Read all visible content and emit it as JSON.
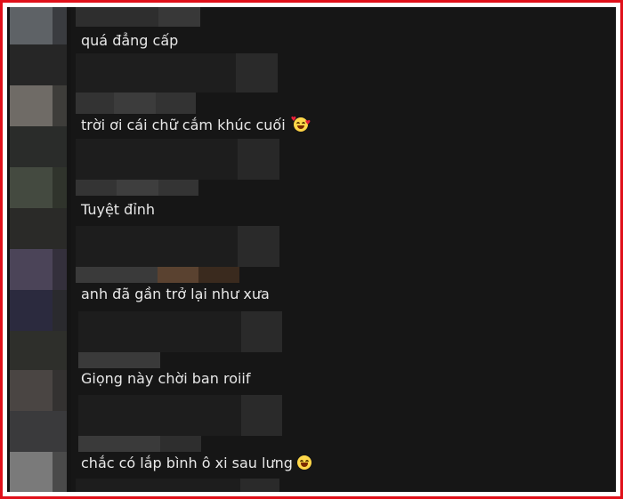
{
  "comments": [
    {
      "text": "quá đẳng cấp",
      "emoji": ""
    },
    {
      "text": "trời ơi cái chữ cắm khúc cuối",
      "emoji": "smiling-face-with-hearts-icon"
    },
    {
      "text": "Tuyệt đỉnh",
      "emoji": ""
    },
    {
      "text": "anh đã gần trở lại như xưa",
      "emoji": ""
    },
    {
      "text": "Giọng này chời ban roiif",
      "emoji": ""
    },
    {
      "text": "chắc có lắp bình ô xi sau lưng",
      "emoji": "laughing-face-icon"
    }
  ],
  "colors": {
    "frame_border": "#e0101a",
    "background": "#161616",
    "comment_text": "#e8e8e8"
  }
}
